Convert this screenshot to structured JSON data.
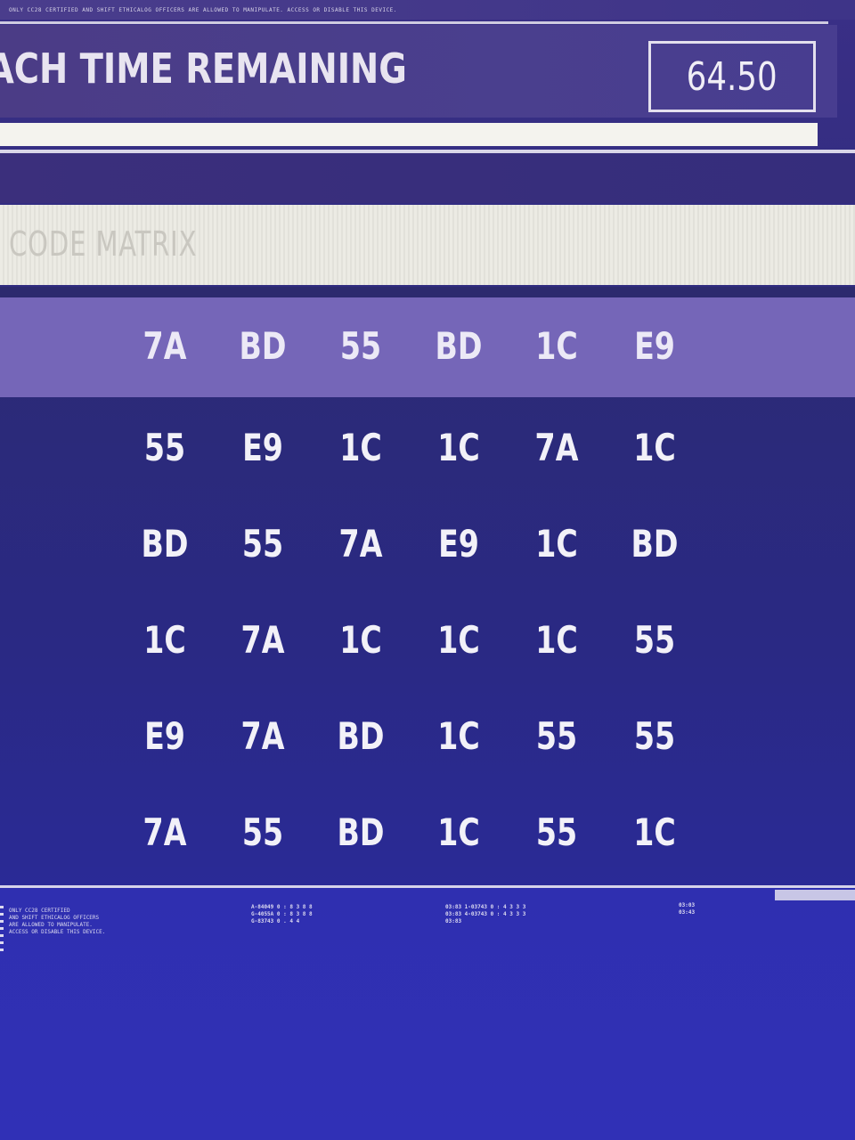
{
  "top_strip": {
    "fine_text": "ONLY CC28 CERTIFIED AND SHIFT ETHICALOG OFFICERS ARE ALLOWED TO MANIPULATE. ACCESS OR DISABLE THIS DEVICE."
  },
  "header": {
    "title": "ACH TIME REMAINING",
    "timer_value": "64.50"
  },
  "progress": {
    "fraction": 1.0
  },
  "matrix": {
    "title": "CODE MATRIX",
    "highlighted_row": 0,
    "rows": [
      [
        "7A",
        "BD",
        "55",
        "BD",
        "1C",
        "E9"
      ],
      [
        "55",
        "E9",
        "1C",
        "1C",
        "7A",
        "1C"
      ],
      [
        "BD",
        "55",
        "7A",
        "E9",
        "1C",
        "BD"
      ],
      [
        "1C",
        "7A",
        "1C",
        "1C",
        "1C",
        "55"
      ],
      [
        "E9",
        "7A",
        "BD",
        "1C",
        "55",
        "55"
      ],
      [
        "7A",
        "55",
        "BD",
        "1C",
        "55",
        "1C"
      ]
    ]
  },
  "footer": {
    "left_text": "ONLY CC28 CERTIFIED\nAND SHIFT ETHICALOG OFFICERS\nARE ALLOWED TO MANIPULATE.\nACCESS OR DISABLE THIS DEVICE.",
    "mid1_text": "A-84049  0 : 8 3 8 8\nG-4055A  0 : 8 3 8 8\nG-83743  0 . 4   4",
    "mid2_text": "03:83 1-03743  0 : 4 3 3 3\n03:83 4-03743  0 : 4 3 3 3\n03:83",
    "right_text": "03:03\n03:43"
  },
  "colors": {
    "background": "#2e2a7e",
    "highlight_row": "#7566b8",
    "text": "#f2f1f8"
  }
}
